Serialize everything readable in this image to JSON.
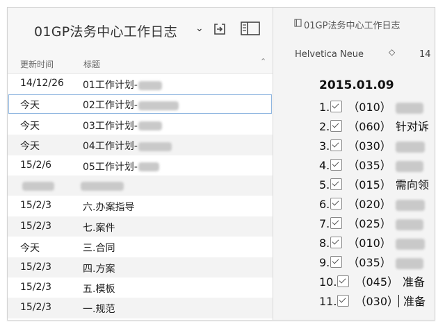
{
  "notebook": {
    "title": "01GP法务中心工作日志",
    "chevron": "⌄"
  },
  "list_header": {
    "date_col": "更新时间",
    "title_col": "标题",
    "sort": "⌃"
  },
  "notes": [
    {
      "date": "14/12/26",
      "title": "01工作计划-",
      "blur": 34
    },
    {
      "date": "今天",
      "title": "02工作计划-",
      "blur": 58
    },
    {
      "date": "今天",
      "title": "03工作计划-",
      "blur": 34
    },
    {
      "date": "今天",
      "title": "04工作计划-",
      "blur": 48
    },
    {
      "date": "15/2/6",
      "title": "05工作计划-",
      "blur": 30
    },
    {
      "date": "",
      "title": "",
      "blur": 0
    },
    {
      "date": "15/2/3",
      "title": "六.办案指导",
      "blur": 0
    },
    {
      "date": "15/2/3",
      "title": "七.案件",
      "blur": 0
    },
    {
      "date": "今天",
      "title": "三.合同",
      "blur": 0
    },
    {
      "date": "15/2/3",
      "title": "四.方案",
      "blur": 0
    },
    {
      "date": "15/2/3",
      "title": "五.模板",
      "blur": 0
    },
    {
      "date": "15/2/3",
      "title": "一.规范",
      "blur": 0
    }
  ],
  "editor": {
    "notebook_title": "01GP法务中心工作日志",
    "font_name": "Helvetica Neue",
    "font_stepper": "◇",
    "font_size": "14",
    "date_heading": "2015.01.09",
    "items": [
      {
        "num": "1.",
        "code": "（010）",
        "text": ""
      },
      {
        "num": "2.",
        "code": "（060）",
        "text": "针对诉"
      },
      {
        "num": "3.",
        "code": "（030）",
        "text": ""
      },
      {
        "num": "4.",
        "code": "（035）",
        "text": ""
      },
      {
        "num": "5.",
        "code": "（015）",
        "text": "需向领"
      },
      {
        "num": "6.",
        "code": "（020）",
        "text": ""
      },
      {
        "num": "7.",
        "code": "（025）",
        "text": ""
      },
      {
        "num": "8.",
        "code": "（010）",
        "text": ""
      },
      {
        "num": "9.",
        "code": "（035）",
        "text": ""
      },
      {
        "num": "10.",
        "code": "（045）",
        "text": "准备"
      },
      {
        "num": "11.",
        "code": "（030）",
        "text": "准备"
      }
    ]
  }
}
